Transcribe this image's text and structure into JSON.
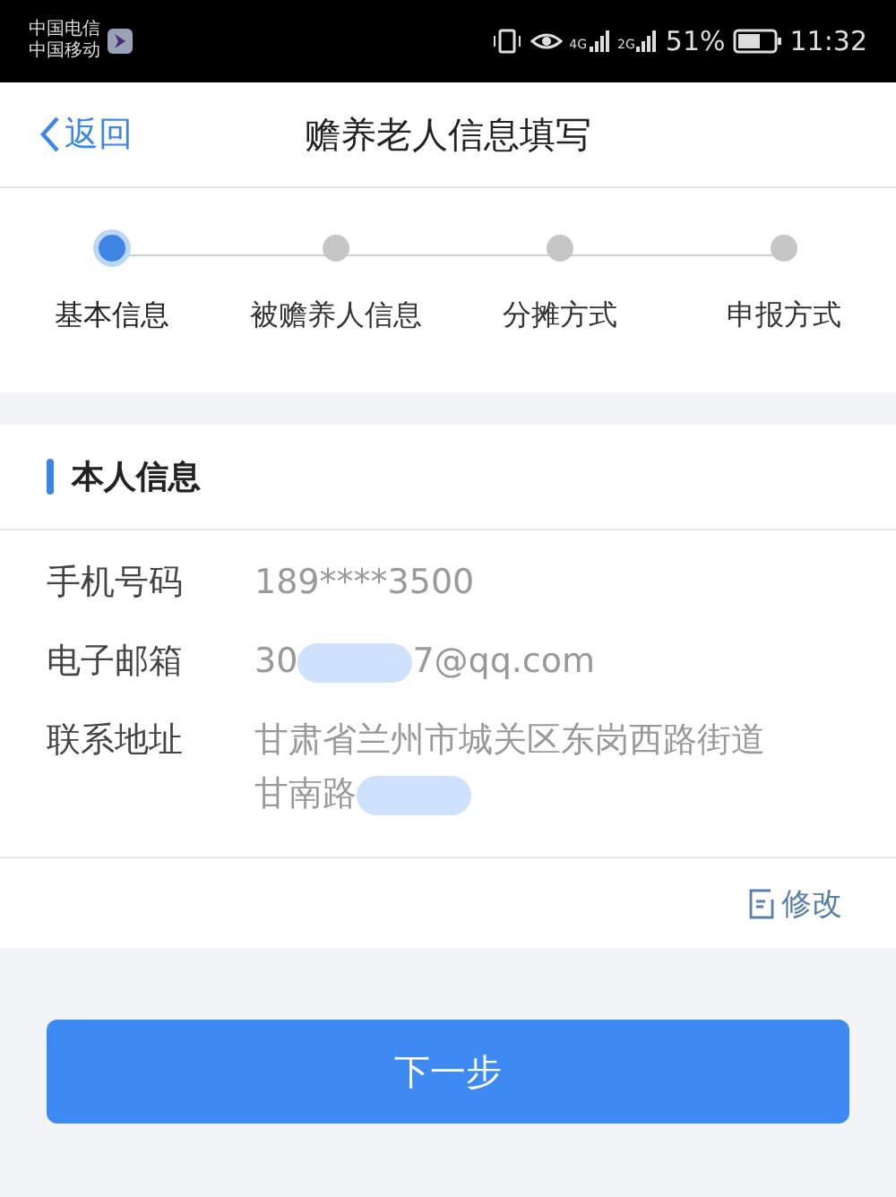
{
  "status_bar": {
    "carriers": [
      "中国电信",
      "中国移动"
    ],
    "signal_labels": [
      "4G",
      "2G"
    ],
    "battery": "51%",
    "time": "11:32"
  },
  "nav": {
    "back": "返回",
    "title": "赡养老人信息填写"
  },
  "steps": [
    {
      "label": "基本信息",
      "selected": true
    },
    {
      "label": "被赡养人信息",
      "selected": false
    },
    {
      "label": "分摊方式",
      "selected": false
    },
    {
      "label": "申报方式",
      "selected": false
    }
  ],
  "section": {
    "title": "本人信息",
    "fields": [
      {
        "label": "手机号码",
        "segments": [
          {
            "kind": "text",
            "text": "189****3500"
          }
        ]
      },
      {
        "label": "电子邮箱",
        "segments": [
          {
            "kind": "text",
            "text": "30"
          },
          {
            "kind": "redaction"
          },
          {
            "kind": "text",
            "text": "7@qq.com"
          }
        ]
      },
      {
        "label": "联系地址",
        "segments": [
          {
            "kind": "text",
            "text": "甘肃省兰州市城关区东岗西路街道甘南路"
          },
          {
            "kind": "redaction"
          }
        ]
      }
    ],
    "edit": "修改"
  },
  "next_button": "下一步"
}
